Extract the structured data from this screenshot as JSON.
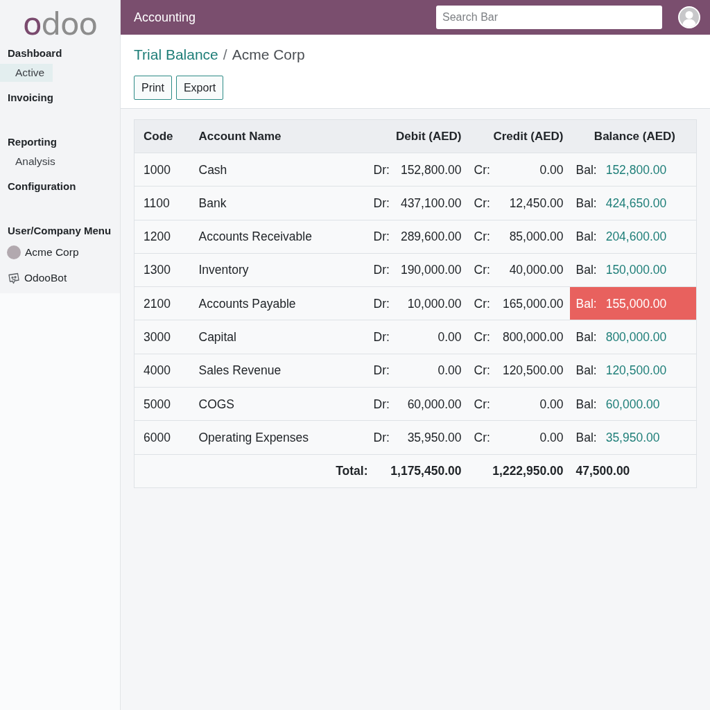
{
  "sidebar": {
    "logo": "odoo",
    "sections": [
      {
        "title": "Dashboard",
        "items": [
          {
            "label": "Active",
            "selected": true
          }
        ]
      },
      {
        "title": "Invoicing"
      },
      {
        "title": "Reporting",
        "items": [
          {
            "label": "Analysis",
            "selected": false
          }
        ]
      },
      {
        "title": "Configuration"
      }
    ],
    "user_menu": {
      "title": "User/Company Menu",
      "items": [
        {
          "label": "Acme Corp",
          "kind": "company"
        },
        {
          "label": "OdooBot",
          "kind": "bot"
        }
      ]
    }
  },
  "topbar": {
    "app_name": "Accounting",
    "search": {
      "placeholder": "Search Bar"
    }
  },
  "breadcrumb": {
    "items": [
      {
        "label": "Trial Balance",
        "kind": "link"
      },
      {
        "label": "Acme Corp",
        "kind": "current"
      }
    ],
    "separator": "/"
  },
  "buttons": [
    "Print",
    "Export"
  ],
  "table": {
    "columns": [
      "Code",
      "Account Name",
      "Debit (AED)",
      "Credit (AED)",
      "Balance (AED)"
    ],
    "rows": [
      {
        "code": "1000",
        "name": "Cash",
        "debit_label": "Dr:",
        "debit": "152,800.00",
        "credit_label": "Cr:",
        "credit": "0.00",
        "balance_label": "Bal:",
        "balance": "152,800.00",
        "flagged": false
      },
      {
        "code": "1100",
        "name": "Bank",
        "debit_label": "Dr:",
        "debit": "437,100.00",
        "credit_label": "Cr:",
        "credit": "12,450.00",
        "balance_label": "Bal:",
        "balance": "424,650.00",
        "flagged": false
      },
      {
        "code": "1200",
        "name": "Accounts Receivable",
        "debit_label": "Dr:",
        "debit": "289,600.00",
        "credit_label": "Cr:",
        "credit": "85,000.00",
        "balance_label": "Bal:",
        "balance": "204,600.00",
        "flagged": false
      },
      {
        "code": "1300",
        "name": "Inventory",
        "debit_label": "Dr:",
        "debit": "190,000.00",
        "credit_label": "Cr:",
        "credit": "40,000.00",
        "balance_label": "Bal:",
        "balance": "150,000.00",
        "flagged": false
      },
      {
        "code": "2100",
        "name": "Accounts Payable",
        "debit_label": "Dr:",
        "debit": "10,000.00",
        "credit_label": "Cr:",
        "credit": "165,000.00",
        "balance_label": "Bal:",
        "balance": "155,000.00",
        "flagged": true
      },
      {
        "code": "3000",
        "name": "Capital",
        "debit_label": "Dr:",
        "debit": "0.00",
        "credit_label": "Cr:",
        "credit": "800,000.00",
        "balance_label": "Bal:",
        "balance": "800,000.00",
        "flagged": false
      },
      {
        "code": "4000",
        "name": "Sales Revenue",
        "debit_label": "Dr:",
        "debit": "0.00",
        "credit_label": "Cr:",
        "credit": "120,500.00",
        "balance_label": "Bal:",
        "balance": "120,500.00",
        "flagged": false
      },
      {
        "code": "5000",
        "name": "COGS",
        "debit_label": "Dr:",
        "debit": "60,000.00",
        "credit_label": "Cr:",
        "credit": "0.00",
        "balance_label": "Bal:",
        "balance": "60,000.00",
        "flagged": false
      },
      {
        "code": "6000",
        "name": "Operating Expenses",
        "debit_label": "Dr:",
        "debit": "35,950.00",
        "credit_label": "Cr:",
        "credit": "0.00",
        "balance_label": "Bal:",
        "balance": "35,950.00",
        "flagged": false
      }
    ],
    "total": {
      "label": "Total:",
      "debit": "1,175,450.00",
      "credit": "1,222,950.00",
      "balance": "47,500.00"
    }
  }
}
